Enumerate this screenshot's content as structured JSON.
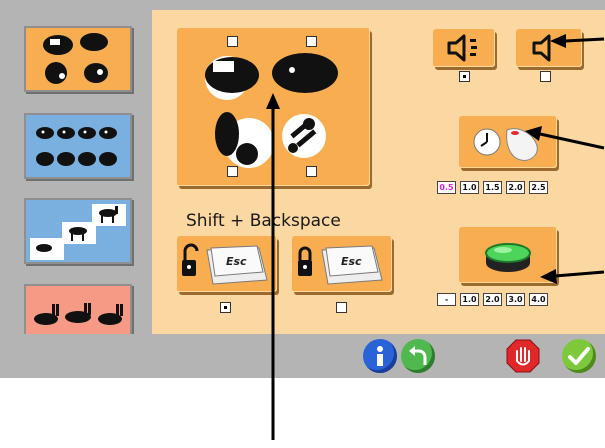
{
  "shortcut": {
    "label": "Shift + Backspace"
  },
  "interval": {
    "options": [
      "0.5",
      "1.0",
      "1.5",
      "2.0",
      "2.5"
    ],
    "selected": "0.5"
  },
  "repeat": {
    "options": [
      "-",
      "1.0",
      "2.0",
      "3.0",
      "4.0"
    ]
  },
  "sound": {
    "voice_checked": true,
    "mute_checked": false
  },
  "lock": {
    "unlocked_checked": true,
    "locked_checked": false
  },
  "colors": {
    "panel": "#fbd7a2",
    "button": "#f8ad50",
    "frame": "#b4b4b4",
    "info": "#2a62d8",
    "back": "#4fb84f",
    "stop": "#e0282a",
    "ok": "#7ec83c",
    "selected_number": "#e020d0"
  },
  "icons": [
    "play-all-icon",
    "speaker-voice-icon",
    "speaker-mute-icon",
    "timer-mouse-icon",
    "green-switch-icon",
    "unlocked-esc-icon",
    "locked-esc-icon",
    "info-icon",
    "back-icon",
    "stop-hand-icon",
    "check-icon"
  ]
}
